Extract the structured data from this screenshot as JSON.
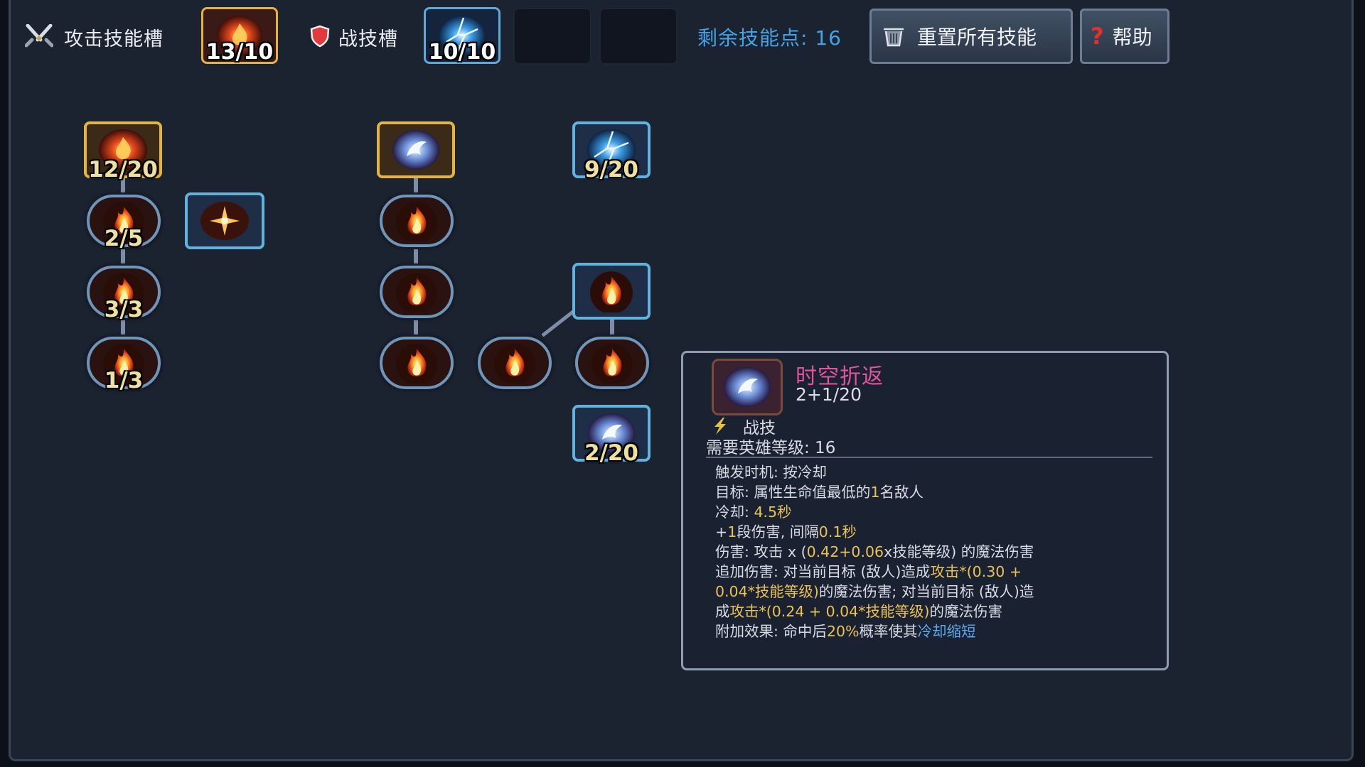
{
  "topbar": {
    "attack_slot_label": "攻击技能槽",
    "attack_slot_count": "13/10",
    "combat_slot_label": "战技槽",
    "combat_slot_count": "10/10",
    "remaining_points": "剩余技能点: 16",
    "reset_label": "重置所有技能",
    "help_label": "帮助",
    "icons": [
      "crossed-swords-icon",
      "shield-icon",
      "trash-icon",
      "question-icon"
    ]
  },
  "tree": {
    "left_root_count": "12/20",
    "left_n1_count": "2/5",
    "left_n2_count": "3/3",
    "left_n3_count": "1/3",
    "right_top_count": "9/20",
    "right_bottom_count": "2/20"
  },
  "tooltip": {
    "name": "时空折返",
    "level": "2+1/20",
    "type": "战技",
    "req": "需要英雄等级: 16",
    "trigger": "触发时机: 按冷却",
    "target_pre": "目标: 属性生命值最低的",
    "target_num": "1",
    "target_post": "名敌人",
    "cd_pre": "冷却: ",
    "cd_val": "4.5秒",
    "hit_pre": "+",
    "hit_num": "1",
    "hit_mid": "段伤害, 间隔",
    "hit_val": "0.1秒",
    "dmg_pre": "伤害: 攻击 x (",
    "dmg_val": "0.42+0.06",
    "dmg_post": "x技能等级) 的魔法伤害",
    "extra_l1_pre": "追加伤害: 对当前目标 (敌人)造成",
    "extra_l1_val": "攻击*(0.30 +",
    "extra_l2_val": "0.04*技能等级)",
    "extra_l2_post": "的魔法伤害; 对当前目标 (敌人)造",
    "extra_l3_pre": "成",
    "extra_l3_val": "攻击*(0.24 + 0.04*技能等级)",
    "extra_l3_post": "的魔法伤害",
    "effect_pre": "附加效果: 命中后",
    "effect_val": "20%",
    "effect_mid": "概率使其",
    "effect_blue": "冷却缩短"
  },
  "colors": {
    "gold_border": "#e4b443",
    "blue_border": "#62b2e0",
    "points_text": "#42a3e6",
    "skill_name": "#e0559c",
    "highlight": "#e9c256"
  }
}
